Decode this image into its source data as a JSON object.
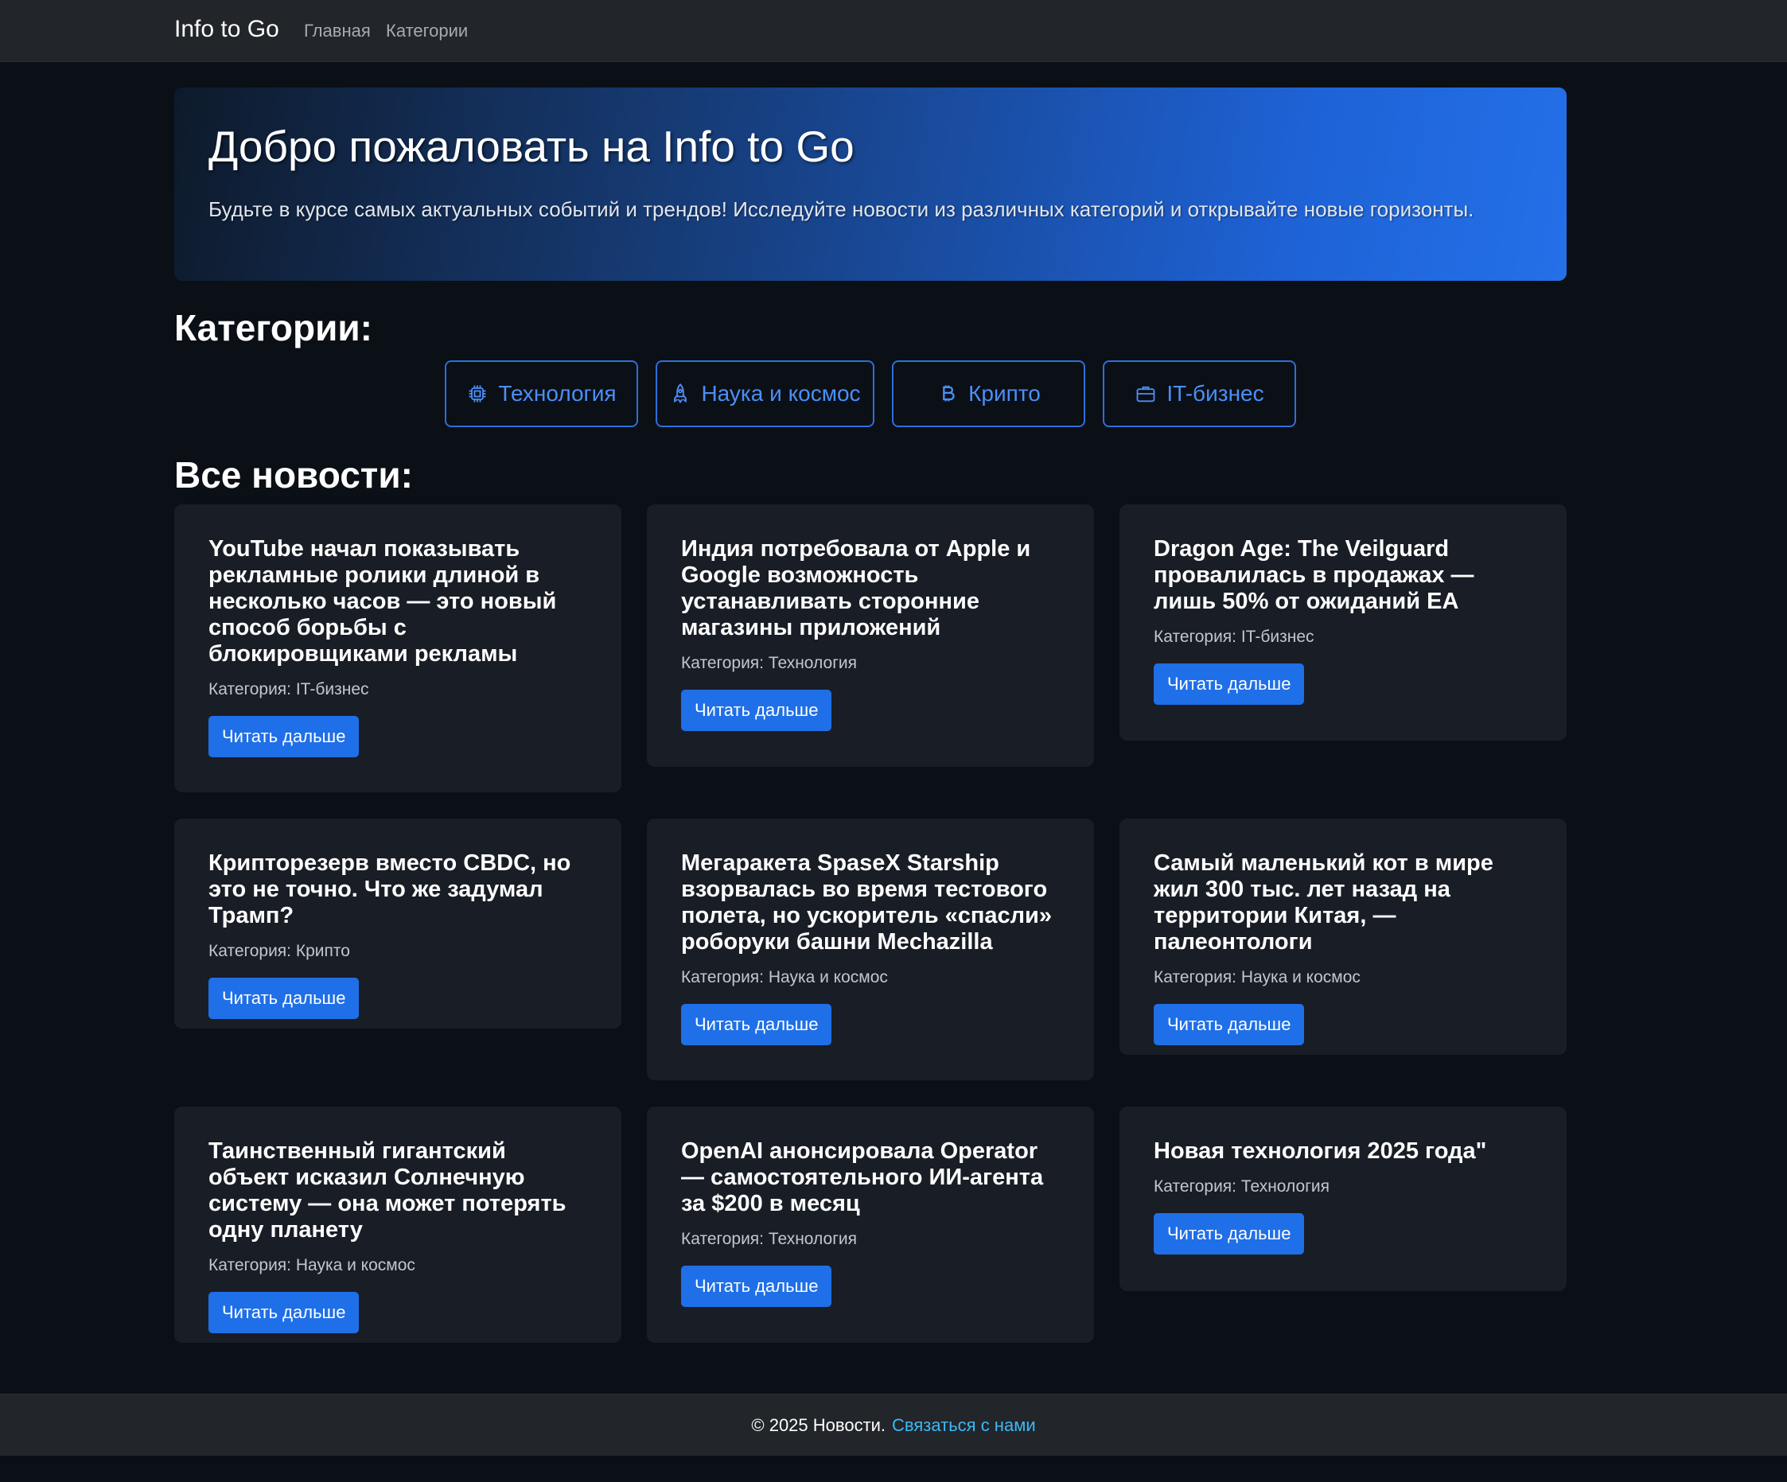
{
  "nav": {
    "brand": "Info to Go",
    "links": [
      "Главная",
      "Категории"
    ]
  },
  "hero": {
    "title": "Добро пожаловать на Info to Go",
    "subtitle": "Будьте в курсе самых актуальных событий и трендов! Исследуйте новости из различных категорий и открывайте новые горизонты."
  },
  "categories": {
    "heading": "Категории:",
    "items": [
      {
        "label": "Технология",
        "icon": "cpu-icon"
      },
      {
        "label": "Наука и космос",
        "icon": "rocket-icon"
      },
      {
        "label": "Крипто",
        "icon": "bitcoin-icon"
      },
      {
        "label": "IT-бизнес",
        "icon": "briefcase-icon"
      }
    ]
  },
  "news": {
    "heading": "Все новости:",
    "button_label": "Читать дальше",
    "items": [
      {
        "title": "YouTube начал показывать рекламные ролики длиной в несколько часов — это новый способ борьбы с блокировщиками рекламы",
        "category": "Категория: IT-бизнес"
      },
      {
        "title": "Индия потребовала от Apple и Google возможность устанавливать сторонние магазины приложений",
        "category": "Категория: Технология"
      },
      {
        "title": "Dragon Age: The Veilguard провалилась в продажах — лишь 50% от ожиданий EA",
        "category": "Категория: IT-бизнес"
      },
      {
        "title": "Крипторезерв вместо CBDC, но это не точно. Что же задумал Трамп?",
        "category": "Категория: Крипто"
      },
      {
        "title": "Мегаракета SpaseX Starship взорвалась во время тестового полета, но ускоритель «спасли» роборуки башни Mechazilla",
        "category": "Категория: Наука и космос"
      },
      {
        "title": "Самый маленький кот в мире жил 300 тыс. лет назад на территории Китая, — палеонтологи",
        "category": "Категория: Наука и космос"
      },
      {
        "title": "Таинственный гигантский объект исказил Солнечную систему — она может потерять одну планету",
        "category": "Категория: Наука и космос"
      },
      {
        "title": "OpenAI анонсировала Operator — самостоятельного ИИ-агента за $200 в месяц",
        "category": "Категория: Технология"
      },
      {
        "title": "Новая технология 2025 года\"",
        "category": "Категория: Технология"
      }
    ]
  },
  "footer": {
    "text": "© 2025 Новости.",
    "link": "Связаться с нами"
  }
}
